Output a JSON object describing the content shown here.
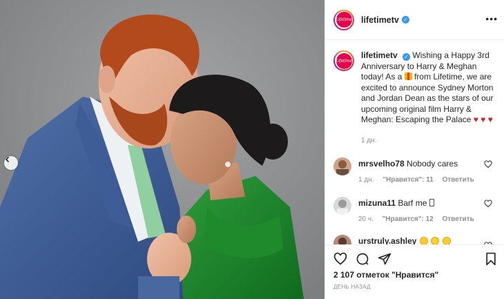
{
  "account": {
    "username": "lifetimetv",
    "avatar_text": "Lifetime",
    "verified_icon": "verified-badge-icon"
  },
  "caption": {
    "username": "lifetimetv",
    "text_before_gift": "Wishing a Happy 3rd Anniversary to Harry & Meghan today! As a",
    "text_after_gift": "from Lifetime, we are excited to announce Sydney Morton and Jordan Dean as the stars of our upcoming original film Harry & Meghan: Escaping the Palace",
    "time": "1 дн."
  },
  "comments": [
    {
      "username": "mrsvelho78",
      "text": "Nobody cares",
      "time": "1 дн.",
      "likes": "\"Нравится\": 11",
      "reply": "Ответить"
    },
    {
      "username": "mizuna11",
      "text": "Barf me",
      "time": "20 ч.",
      "likes": "\"Нравится\": 12",
      "reply": "Ответить"
    },
    {
      "username": "urstruly.ashley",
      "text": ""
    }
  ],
  "footer": {
    "likes_count": "2 107 отметок",
    "likes_word": "\"Нравится\"",
    "date": "День назад"
  },
  "colors": {
    "brand_pink": "#e4004b",
    "verified_blue": "#3897f0",
    "muted_text": "#8e8e8e",
    "heart_red": "#d61f2c"
  }
}
